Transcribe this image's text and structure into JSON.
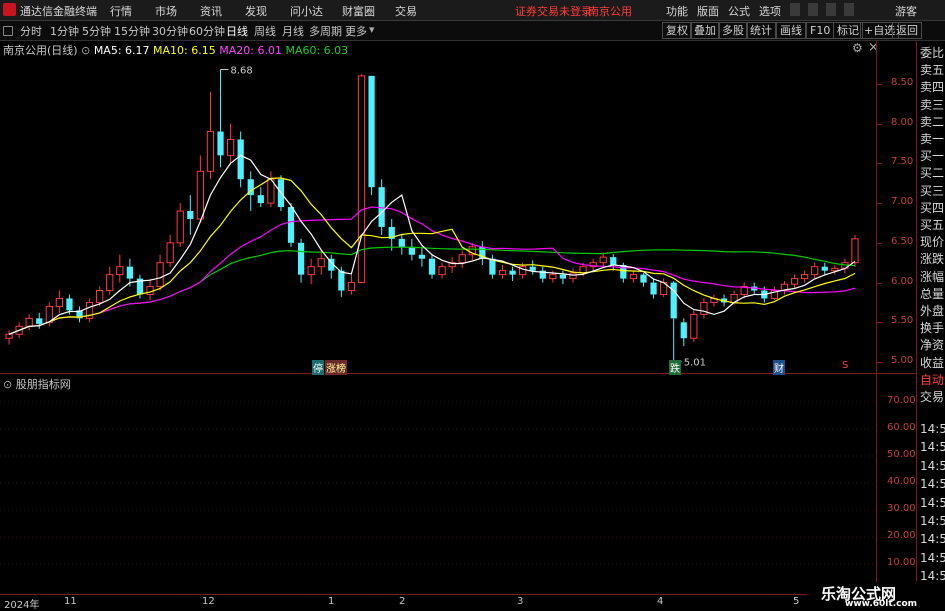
{
  "menubar": {
    "app_title": "通达信金融终端",
    "menus": [
      "行情",
      "市场",
      "资讯",
      "发现",
      "问小达",
      "财富圈",
      "交易"
    ],
    "notice": "证券交易未登录",
    "stock": "南京公用",
    "right_menus": [
      "功能",
      "版面",
      "公式",
      "选项"
    ],
    "user": "游客"
  },
  "periodbar": {
    "periods": [
      "分时",
      "1分钟",
      "5分钟",
      "15分钟",
      "30分钟",
      "60分钟",
      "日线",
      "周线",
      "月线",
      "多周期",
      "更多"
    ],
    "active": "日线",
    "tools": [
      "复权",
      "叠加",
      "多股",
      "统计",
      "画线",
      "F10",
      "标记",
      "+自选",
      "返回"
    ]
  },
  "chart_header": {
    "title": "南京公用(日线)",
    "ma5": "MA5: 6.17",
    "ma10": "MA10: 6.15",
    "ma20": "MA20: 6.01",
    "ma60": "MA60: 6.03",
    "ma_colors": {
      "ma5": "#ffffff",
      "ma10": "#ffff00",
      "ma20": "#ff00ff",
      "ma60": "#00cc00"
    }
  },
  "side_panel": {
    "items": [
      "委比",
      "卖五",
      "卖四",
      "卖三",
      "卖二",
      "卖一",
      "买一",
      "买二",
      "买三",
      "买四",
      "买五",
      "现价",
      "涨跌",
      "涨幅",
      "总量",
      "外盘",
      "换手",
      "净资",
      "收益",
      "自动",
      "交易"
    ],
    "times": [
      "14:5",
      "14:5",
      "14:5",
      "14:5",
      "14:5",
      "14:5",
      "14:5",
      "14:5",
      "14:5"
    ]
  },
  "indicator": {
    "title": "股朋指标网",
    "axis": [
      "70.00",
      "60.00",
      "50.00",
      "40.00",
      "30.00",
      "20.00",
      "10.00"
    ]
  },
  "markers": {
    "tags": [
      "停",
      "涨榜",
      "跌",
      "财",
      "S"
    ]
  },
  "footer": {
    "year": "2024年",
    "months": [
      "11",
      "12",
      "1",
      "2",
      "3",
      "4",
      "5"
    ]
  },
  "watermark": {
    "title": "乐淘公式网",
    "url": "www.60lt.com"
  },
  "chart_data": {
    "type": "candlestick",
    "y_range": [
      4.85,
      8.85
    ],
    "y_ticks": [
      5.0,
      5.5,
      6.0,
      6.5,
      7.0,
      7.5,
      8.0,
      8.5
    ],
    "high_label": "8.68",
    "low_label": "5.01",
    "candles": [
      [
        5.3,
        5.35,
        5.22,
        5.4
      ],
      [
        5.35,
        5.45,
        5.3,
        5.5
      ],
      [
        5.45,
        5.55,
        5.4,
        5.6
      ],
      [
        5.55,
        5.48,
        5.42,
        5.62
      ],
      [
        5.5,
        5.7,
        5.45,
        5.75
      ],
      [
        5.7,
        5.8,
        5.62,
        5.9
      ],
      [
        5.8,
        5.65,
        5.6,
        5.85
      ],
      [
        5.65,
        5.55,
        5.5,
        5.7
      ],
      [
        5.55,
        5.75,
        5.5,
        5.8
      ],
      [
        5.75,
        5.9,
        5.7,
        5.95
      ],
      [
        5.9,
        6.1,
        5.85,
        6.2
      ],
      [
        6.1,
        6.2,
        6.0,
        6.35
      ],
      [
        6.2,
        6.05,
        5.95,
        6.3
      ],
      [
        6.05,
        5.85,
        5.8,
        6.1
      ],
      [
        5.85,
        5.95,
        5.78,
        6.05
      ],
      [
        5.95,
        6.25,
        5.9,
        6.35
      ],
      [
        6.25,
        6.5,
        6.2,
        6.6
      ],
      [
        6.5,
        6.9,
        6.45,
        7.0
      ],
      [
        6.9,
        6.8,
        6.6,
        7.1
      ],
      [
        6.8,
        7.4,
        6.75,
        7.6
      ],
      [
        7.4,
        7.9,
        7.3,
        8.4
      ],
      [
        7.9,
        7.6,
        7.45,
        8.68
      ],
      [
        7.6,
        7.8,
        7.5,
        8.0
      ],
      [
        7.8,
        7.3,
        7.2,
        7.9
      ],
      [
        7.3,
        7.1,
        6.9,
        7.4
      ],
      [
        7.1,
        7.0,
        6.95,
        7.2
      ],
      [
        7.0,
        7.3,
        6.95,
        7.4
      ],
      [
        7.3,
        6.95,
        6.9,
        7.35
      ],
      [
        6.95,
        6.5,
        6.45,
        7.0
      ],
      [
        6.5,
        6.1,
        6.0,
        6.55
      ],
      [
        6.1,
        6.2,
        5.98,
        6.3
      ],
      [
        6.2,
        6.3,
        6.1,
        6.4
      ],
      [
        6.3,
        6.15,
        6.05,
        6.35
      ],
      [
        6.15,
        5.9,
        5.82,
        6.2
      ],
      [
        5.9,
        6.0,
        5.85,
        6.1
      ],
      [
        6.0,
        8.6,
        6.0,
        8.62
      ],
      [
        8.6,
        7.2,
        7.1,
        8.6
      ],
      [
        7.2,
        6.7,
        6.6,
        7.3
      ],
      [
        6.7,
        6.55,
        6.4,
        6.8
      ],
      [
        6.55,
        6.45,
        6.35,
        6.6
      ],
      [
        6.45,
        6.35,
        6.28,
        6.55
      ],
      [
        6.35,
        6.3,
        6.2,
        6.45
      ],
      [
        6.3,
        6.1,
        6.05,
        6.35
      ],
      [
        6.1,
        6.2,
        6.05,
        6.25
      ],
      [
        6.2,
        6.25,
        6.12,
        6.32
      ],
      [
        6.25,
        6.35,
        6.18,
        6.4
      ],
      [
        6.35,
        6.45,
        6.28,
        6.5
      ],
      [
        6.45,
        6.3,
        6.22,
        6.52
      ],
      [
        6.3,
        6.1,
        6.05,
        6.35
      ],
      [
        6.1,
        6.15,
        6.05,
        6.22
      ],
      [
        6.15,
        6.1,
        6.02,
        6.2
      ],
      [
        6.1,
        6.2,
        6.05,
        6.25
      ],
      [
        6.2,
        6.15,
        6.1,
        6.28
      ],
      [
        6.15,
        6.05,
        6.0,
        6.2
      ],
      [
        6.05,
        6.1,
        6.0,
        6.15
      ],
      [
        6.1,
        6.05,
        5.98,
        6.15
      ],
      [
        6.05,
        6.12,
        6.0,
        6.18
      ],
      [
        6.12,
        6.2,
        6.08,
        6.25
      ],
      [
        6.2,
        6.25,
        6.15,
        6.3
      ],
      [
        6.25,
        6.32,
        6.2,
        6.38
      ],
      [
        6.32,
        6.22,
        6.15,
        6.36
      ],
      [
        6.22,
        6.05,
        6.0,
        6.25
      ],
      [
        6.05,
        6.1,
        6.0,
        6.15
      ],
      [
        6.1,
        6.0,
        5.95,
        6.12
      ],
      [
        6.0,
        5.85,
        5.8,
        6.05
      ],
      [
        5.85,
        6.0,
        5.82,
        6.05
      ],
      [
        6.0,
        5.55,
        5.01,
        6.02
      ],
      [
        5.5,
        5.3,
        5.2,
        5.55
      ],
      [
        5.3,
        5.6,
        5.25,
        5.65
      ],
      [
        5.6,
        5.75,
        5.55,
        5.8
      ],
      [
        5.75,
        5.8,
        5.7,
        5.85
      ],
      [
        5.8,
        5.75,
        5.7,
        5.85
      ],
      [
        5.75,
        5.85,
        5.72,
        5.9
      ],
      [
        5.85,
        5.95,
        5.8,
        6.0
      ],
      [
        5.95,
        5.9,
        5.85,
        6.0
      ],
      [
        5.9,
        5.8,
        5.75,
        5.95
      ],
      [
        5.8,
        5.9,
        5.78,
        5.95
      ],
      [
        5.9,
        5.98,
        5.85,
        6.02
      ],
      [
        5.98,
        6.05,
        5.92,
        6.1
      ],
      [
        6.05,
        6.1,
        6.0,
        6.15
      ],
      [
        6.1,
        6.2,
        6.05,
        6.25
      ],
      [
        6.2,
        6.15,
        6.1,
        6.25
      ],
      [
        6.15,
        6.18,
        6.1,
        6.22
      ],
      [
        6.18,
        6.25,
        6.12,
        6.3
      ],
      [
        6.25,
        6.55,
        6.2,
        6.6
      ]
    ]
  }
}
